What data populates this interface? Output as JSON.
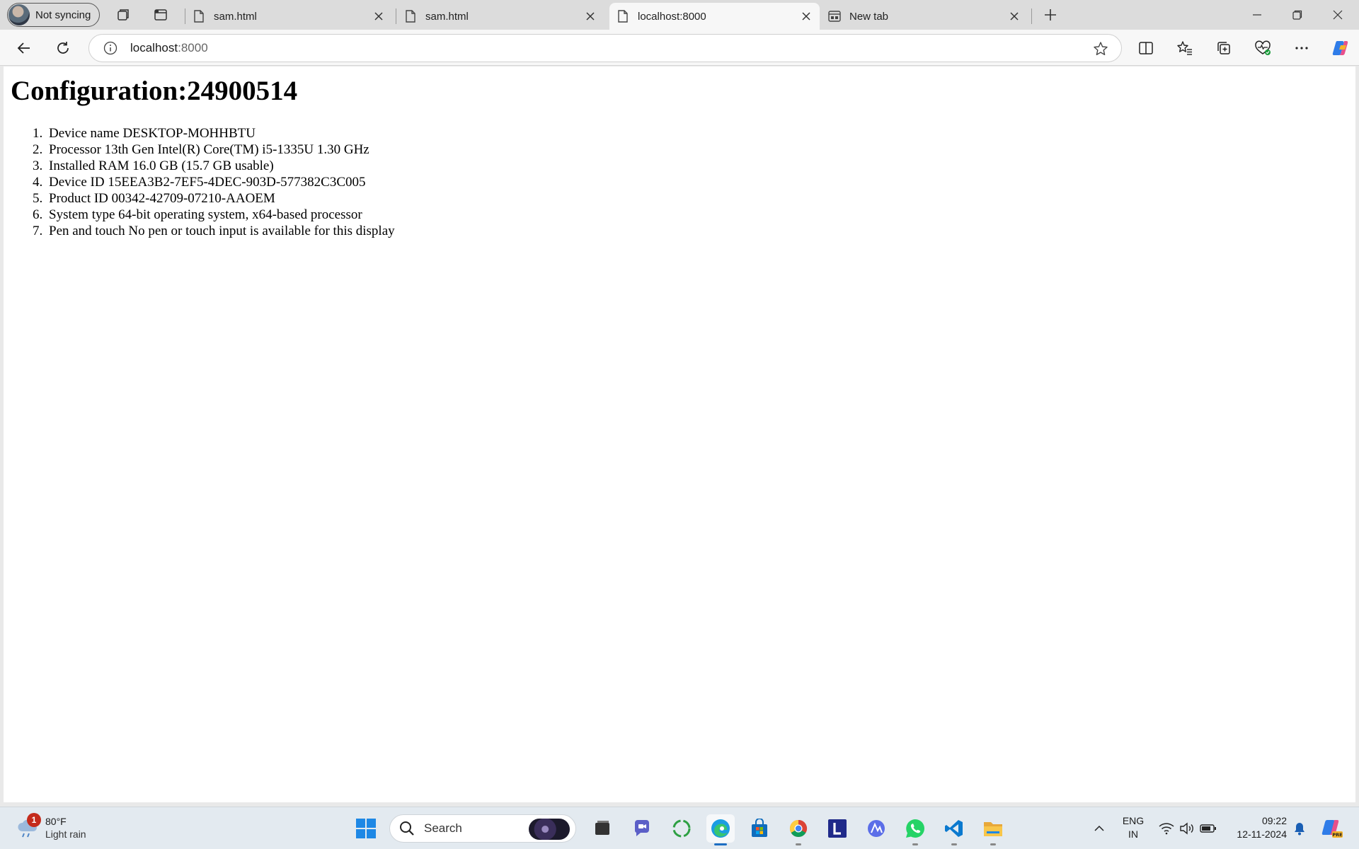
{
  "browser": {
    "profile_label": "Not syncing",
    "tabs": [
      {
        "title": "sam.html",
        "icon": "page-icon",
        "active": false
      },
      {
        "title": "sam.html",
        "icon": "page-icon",
        "active": false
      },
      {
        "title": "localhost:8000",
        "icon": "page-icon",
        "active": true
      },
      {
        "title": "New tab",
        "icon": "newtab-icon",
        "active": false
      }
    ],
    "address": {
      "host": "localhost",
      "port": ":8000"
    }
  },
  "page": {
    "heading": "Configuration:24900514",
    "items": [
      "Device name DESKTOP-MOHHBTU",
      "Processor 13th Gen Intel(R) Core(TM) i5-1335U 1.30 GHz",
      "Installed RAM 16.0 GB (15.7 GB usable)",
      "Device ID 15EEA3B2-7EF5-4DEC-903D-577382C3C005",
      "Product ID 00342-42709-07210-AAOEM",
      "System type 64-bit operating system, x64-based processor",
      "Pen and touch No pen or touch input is available for this display"
    ]
  },
  "taskbar": {
    "weather": {
      "badge": "1",
      "temp": "80°F",
      "condition": "Light rain"
    },
    "search_label": "Search",
    "language": {
      "line1": "ENG",
      "line2": "IN"
    },
    "clock": {
      "time": "09:22",
      "date": "12-11-2024"
    }
  }
}
